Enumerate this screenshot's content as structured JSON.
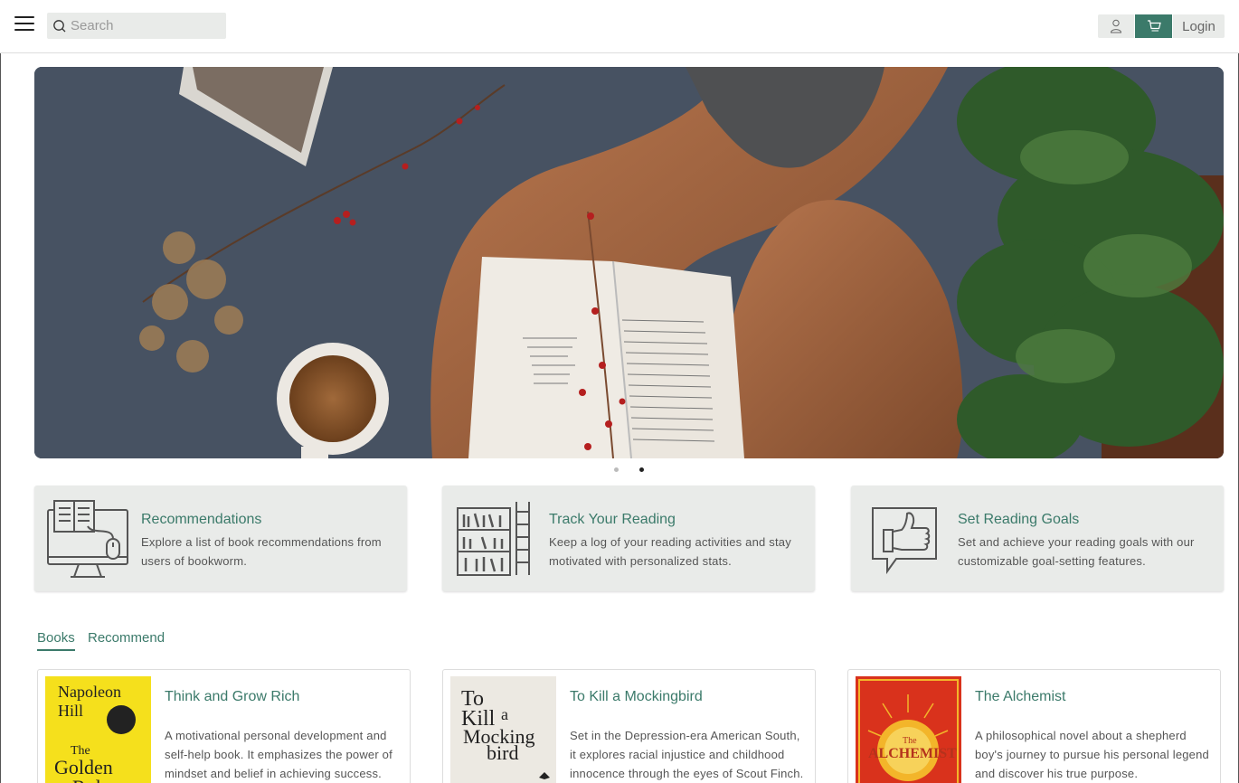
{
  "header": {
    "menu_icon": "hamburger-menu-icon",
    "search_placeholder": "Search",
    "user_icon": "user-icon",
    "cart_icon": "cart-icon",
    "login_label": "Login",
    "accent_color": "#3b7a6a"
  },
  "hero": {
    "carousel_dot_count": 2,
    "active_slide": 2
  },
  "features": [
    {
      "icon": "computer-book-icon",
      "title": "Recommendations",
      "description": "Explore a list of book recommendations from users of bookworm."
    },
    {
      "icon": "bookshelf-ladder-icon",
      "title": "Track Your Reading",
      "description": "Keep a log of your reading activities and stay motivated with personalized stats."
    },
    {
      "icon": "thumbs-up-icon",
      "title": "Set Reading Goals",
      "description": "Set and achieve your reading goals with our customizable goal-setting features."
    }
  ],
  "tabs": [
    {
      "label": "Books",
      "active": true
    },
    {
      "label": "Recommend",
      "active": false
    }
  ],
  "books": [
    {
      "title": "Think and Grow Rich",
      "description": "A motivational personal development and self-help book. It emphasizes the power of mindset and belief in achieving success.",
      "cover_author": "Napoleon Hill",
      "cover_line1": "Napoleon",
      "cover_line2": "Hill",
      "cover_line3": "The",
      "cover_line4": "Golden",
      "cover_line5": "Rules"
    },
    {
      "title": "To Kill a Mockingbird",
      "description": "Set in the Depression-era American South, it explores racial injustice and childhood innocence through the eyes of Scout Finch.",
      "cover_line1": "To",
      "cover_line2": "Kill",
      "cover_line3": "a",
      "cover_line4": "Mocking",
      "cover_line5": "bird"
    },
    {
      "title": "The Alchemist",
      "description": "A philosophical novel about a shepherd boy's journey to pursue his personal legend and discover his true purpose.",
      "cover_line1": "The",
      "cover_line2": "ALCHEMIST"
    }
  ]
}
